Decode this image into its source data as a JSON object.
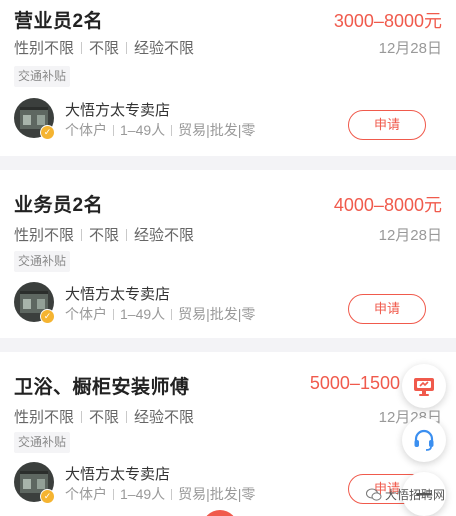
{
  "jobs": [
    {
      "title": "营业员2名",
      "salary": "3000–8000元",
      "requirements": [
        "性别不限",
        "不限",
        "经验不限"
      ],
      "date": "12月28日",
      "tag": "交通补贴",
      "company": {
        "name": "大悟方太专卖店",
        "meta": [
          "个体户",
          "1–49人",
          "贸易|批发|零"
        ]
      },
      "apply_label": "申请"
    },
    {
      "title": "业务员2名",
      "salary": "4000–8000元",
      "requirements": [
        "性别不限",
        "不限",
        "经验不限"
      ],
      "date": "12月28日",
      "tag": "交通补贴",
      "company": {
        "name": "大悟方太专卖店",
        "meta": [
          "个体户",
          "1–49人",
          "贸易|批发|零"
        ]
      },
      "apply_label": "申请"
    },
    {
      "title": "卫浴、橱柜安装师傅",
      "salary": "5000–1500",
      "requirements": [
        "性别不限",
        "不限",
        "经验不限"
      ],
      "date": "12月28日",
      "tag": "交通补贴",
      "company": {
        "name": "大悟方太专卖店",
        "meta": [
          "个体户",
          "1–49人",
          "贸易|批发|零"
        ]
      },
      "apply_label": "申请"
    }
  ],
  "floating": {
    "icons": [
      "monitor-icon",
      "headset-icon",
      "minus-icon"
    ]
  },
  "watermark": {
    "text": "大悟招聘网",
    "icon": "wechat-icon"
  },
  "colors": {
    "accent": "#f05a4c",
    "verified": "#f5b431",
    "background": "#f3f3f6"
  }
}
